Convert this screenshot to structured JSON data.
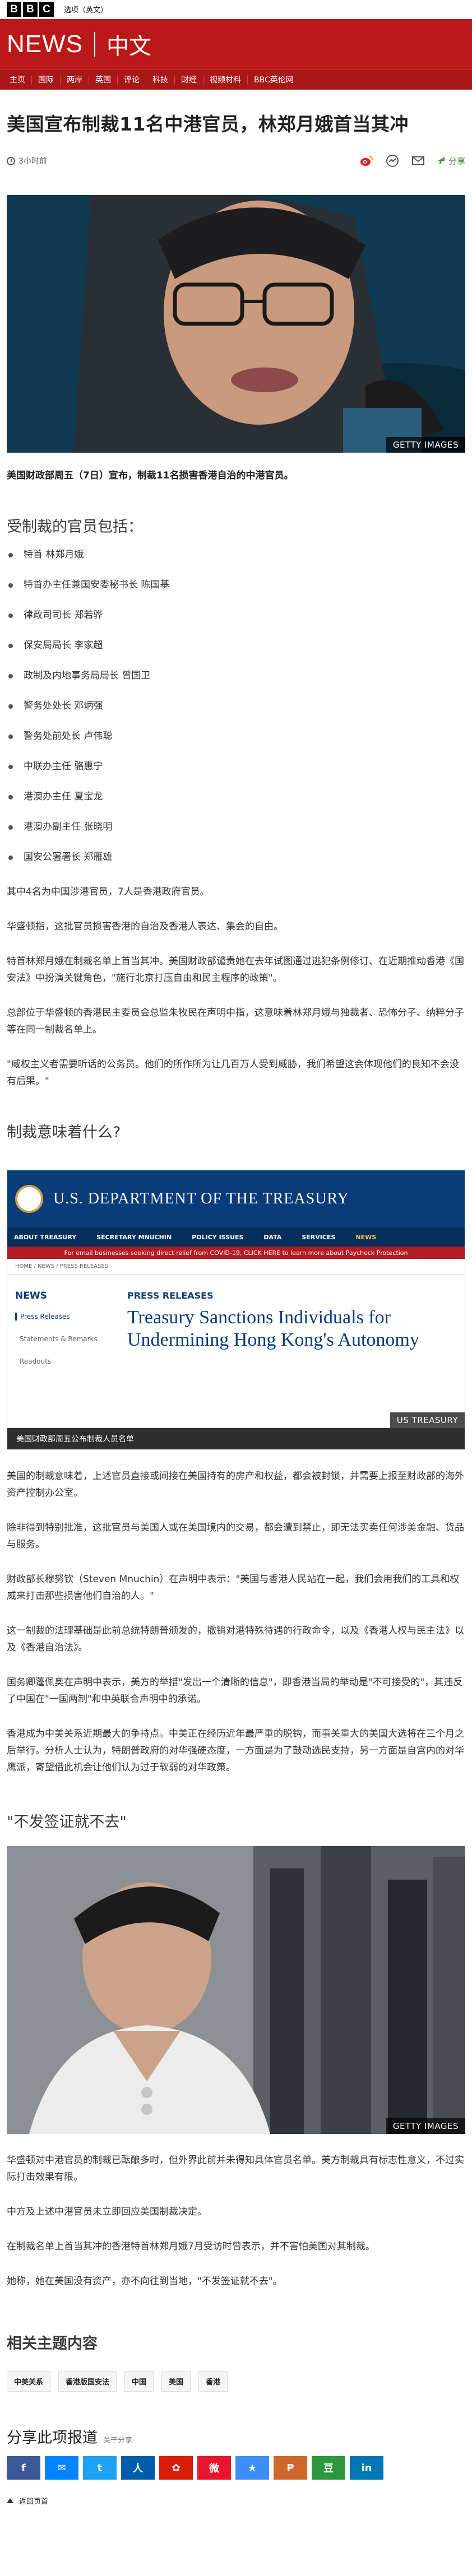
{
  "topbar": {
    "logo": [
      "B",
      "B",
      "C"
    ],
    "lang_link": "选项（英文）"
  },
  "masthead": {
    "brand": "NEWS",
    "lang": "中文"
  },
  "nav": [
    "主页",
    "国际",
    "两岸",
    "英国",
    "评论",
    "科技",
    "财经",
    "视频材料",
    "BBC英伦网"
  ],
  "article": {
    "headline": "美国宣布制裁11名中港官员，林郑月娥首当其冲",
    "timestamp": "3小时前",
    "share_label": "分享",
    "hero_caption": "GETTY IMAGES",
    "lead": "美国财政部周五（7日）宣布，制裁11名损害香港自治的中港官员。",
    "section1": "受制裁的官员包括：",
    "officials": [
      "特首 林郑月娥",
      "特首办主任兼国安委秘书长 陈国基",
      "律政司司长 郑若骅",
      "保安局局长 李家超",
      "政制及内地事务局局长 曾国卫",
      "警务处处长 邓炳强",
      "警务处前处长 卢伟聪",
      "中联办主任 骆惠宁",
      "港澳办主任 夏宝龙",
      "港澳办副主任 张晓明",
      "国安公署署长 郑雁雄"
    ],
    "p1": "其中4名为中国涉港官员，7人是香港政府官员。",
    "p2": "华盛顿指，这批官员损害香港的自治及香港人表达、集会的自由。",
    "p3": "特首林郑月娥在制裁名单上首当其冲。美国财政部谴责她在去年试图通过逃犯条例修订、在近期推动香港《国安法》中扮演关键角色，\"施行北京打压自由和民主程序的政策\"。",
    "p4": "总部位于华盛顿的香港民主委员会总监朱牧民在声明中指，这意味着林郑月娥与独裁者、恐怖分子、纳粹分子等在同一制裁名单上。",
    "p5": "\"威权主义者需要听话的公务员。他们的所作所为让几百万人受到威胁，我们希望这会体现他们的良知不会没有后果。\"",
    "section2": "制裁意味着什么?",
    "treasury": {
      "title": "U.S. DEPARTMENT OF THE TREASURY",
      "nav": [
        "ABOUT TREASURY",
        "SECRETARY MNUCHIN",
        "POLICY ISSUES",
        "DATA",
        "SERVICES",
        "NEWS"
      ],
      "alert": "For email businesses seeking direct relief from COVID-19, CLICK HERE to learn more about Paycheck Protection",
      "crumb": "HOME  /  NEWS  /  PRESS RELEASES",
      "side_head": "NEWS",
      "side_items": [
        "Press Releases",
        "Statements & Remarks",
        "Readouts"
      ],
      "main_head": "PRESS RELEASES",
      "main_title": "Treasury Sanctions Individuals for Undermining Hong Kong's Autonomy",
      "badge": "US TREASURY",
      "caption": "美国财政部周五公布制裁人员名单"
    },
    "p6": "美国的制裁意味着，上述官员直接或间接在美国持有的房产和权益，都会被封锁，并需要上报至财政部的海外资产控制办公室。",
    "p7": "除非得到特别批准，这批官员与美国人或在美国境内的交易，都会遭到禁止，即无法买卖任何涉美金融、货品与服务。",
    "p8": "财政部长穆努钦（Steven Mnuchin）在声明中表示：\"美国与香港人民站在一起，我们会用我们的工具和权威来打击那些损害他们自治的人。\"",
    "p9": "这一制裁的法理基础是此前总统特朗普颁发的，撤销对港特殊待遇的行政命令，以及《香港人权与民主法》以及《香港自治法》。",
    "p10": "国务卿蓬佩奥在声明中表示，美方的举措\"发出一个清晰的信息\"，即香港当局的举动是\"不可接受的\"，其违反了中国在\"一国两制\"和中英联合声明中的承诺。",
    "p11": "香港成为中美关系近期最大的争持点。中美正在经历近年最严重的脱钩，而事关重大的美国大选将在三个月之后举行。分析人士认为，特朗普政府的对华强硬态度，一方面是为了鼓动选民支持，另一方面是自宫内的对华鹰派，寄望借此机会让他们认为过于软弱的对华政策。",
    "section3": "\"不发签证就不去\"",
    "photo2_caption": "GETTY IMAGES",
    "p12": "华盛顿对中港官员的制裁已酝酿多时，但外界此前并未得知具体官员名单。美方制裁具有标志性意义，不过实际打击效果有限。",
    "p13": "中方及上述中港官员未立即回应美国制裁决定。",
    "p14": "在制裁名单上首当其冲的香港特首林郑月娥7月受访时曾表示，并不害怕美国对其制裁。",
    "p15": "她称，她在美国没有资产，亦不向往到当地，\"不发签证就不去\"。"
  },
  "related": {
    "title": "相关主题内容",
    "tags": [
      "中美关系",
      "香港版国安法",
      "中国",
      "美国",
      "香港"
    ]
  },
  "share": {
    "title": "分享此项报道",
    "subtitle": "关于分享",
    "buttons": [
      {
        "name": "facebook",
        "glyph": "f",
        "color": "#3b5998"
      },
      {
        "name": "messenger",
        "glyph": "✉",
        "color": "#0084ff"
      },
      {
        "name": "twitter",
        "glyph": "t",
        "color": "#1da1f2"
      },
      {
        "name": "renren",
        "glyph": "人",
        "color": "#005baa"
      },
      {
        "name": "kaixin",
        "glyph": "✿",
        "color": "#d81e06"
      },
      {
        "name": "weibo",
        "glyph": "微",
        "color": "#e6162d"
      },
      {
        "name": "favorites",
        "glyph": "★",
        "color": "#3f8ef5"
      },
      {
        "name": "plurk",
        "glyph": "P",
        "color": "#cf682f"
      },
      {
        "name": "douban",
        "glyph": "豆",
        "color": "#2e963d"
      },
      {
        "name": "linkedin",
        "glyph": "in",
        "color": "#0077b5"
      }
    ]
  },
  "footer": {
    "back_to_top": "返回页首"
  }
}
